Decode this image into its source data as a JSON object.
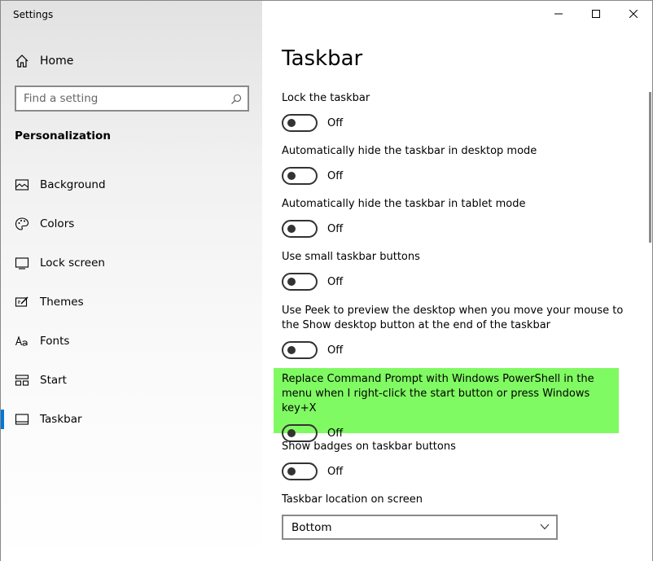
{
  "window": {
    "title": "Settings"
  },
  "sidebar": {
    "home_label": "Home",
    "search_placeholder": "Find a setting",
    "section_title": "Personalization",
    "items": [
      {
        "label": "Background",
        "icon": "picture-icon"
      },
      {
        "label": "Colors",
        "icon": "palette-icon"
      },
      {
        "label": "Lock screen",
        "icon": "lock-screen-icon"
      },
      {
        "label": "Themes",
        "icon": "themes-icon"
      },
      {
        "label": "Fonts",
        "icon": "fonts-icon"
      },
      {
        "label": "Start",
        "icon": "start-icon"
      },
      {
        "label": "Taskbar",
        "icon": "taskbar-icon",
        "active": true
      }
    ]
  },
  "content": {
    "title": "Taskbar",
    "settings": [
      {
        "label": "Lock the taskbar",
        "state": "Off"
      },
      {
        "label": "Automatically hide the taskbar in desktop mode",
        "state": "Off"
      },
      {
        "label": "Automatically hide the taskbar in tablet mode",
        "state": "Off"
      },
      {
        "label": "Use small taskbar buttons",
        "state": "Off"
      },
      {
        "label": "Use Peek to preview the desktop when you move your mouse to the Show desktop button at the end of the taskbar",
        "state": "Off"
      },
      {
        "label": "Replace Command Prompt with Windows PowerShell in the menu when I right-click the start button or press Windows key+X",
        "state": "Off",
        "highlighted": true
      },
      {
        "label": "Show badges on taskbar buttons",
        "state": "Off"
      }
    ],
    "location_label": "Taskbar location on screen",
    "location_value": "Bottom"
  },
  "colors": {
    "accent": "#0078d7",
    "highlight": "#80fa62"
  }
}
